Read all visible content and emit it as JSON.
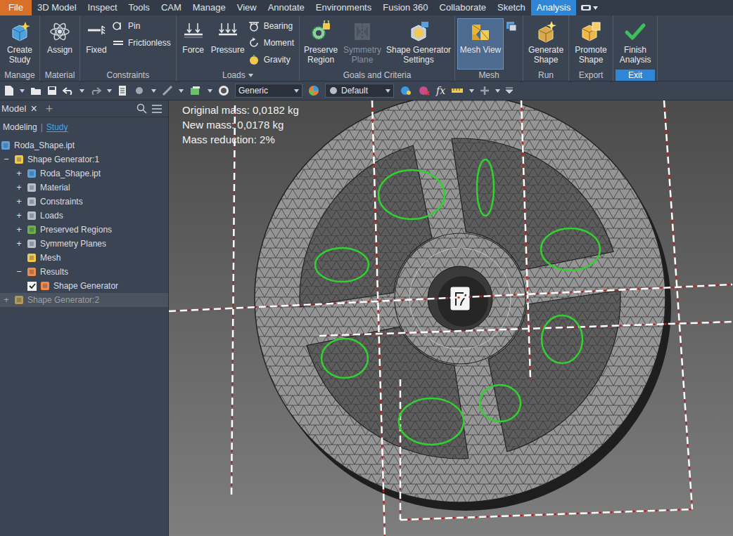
{
  "menu_tabs": [
    {
      "label": "File",
      "kind": "file",
      "selected": false
    },
    {
      "label": "3D Model",
      "kind": "tab",
      "selected": false
    },
    {
      "label": "Inspect",
      "kind": "tab",
      "selected": false
    },
    {
      "label": "Tools",
      "kind": "tab",
      "selected": false
    },
    {
      "label": "CAM",
      "kind": "tab",
      "selected": false
    },
    {
      "label": "Manage",
      "kind": "tab",
      "selected": false
    },
    {
      "label": "View",
      "kind": "tab",
      "selected": false
    },
    {
      "label": "Annotate",
      "kind": "tab",
      "selected": false
    },
    {
      "label": "Environments",
      "kind": "tab",
      "selected": false
    },
    {
      "label": "Fusion 360",
      "kind": "tab",
      "selected": false
    },
    {
      "label": "Collaborate",
      "kind": "tab",
      "selected": false
    },
    {
      "label": "Sketch",
      "kind": "tab",
      "selected": false
    },
    {
      "label": "Analysis",
      "kind": "tab",
      "selected": true
    }
  ],
  "ribbon": {
    "groups": [
      {
        "label": "Manage",
        "highlighted": false,
        "dropdown": false,
        "items": [
          {
            "kind": "large",
            "label": "Create Study",
            "disabled": false,
            "selected": false
          }
        ]
      },
      {
        "label": "Material",
        "highlighted": false,
        "dropdown": false,
        "items": [
          {
            "kind": "large",
            "label": "Assign",
            "disabled": false,
            "selected": false
          }
        ]
      },
      {
        "label": "Constraints",
        "highlighted": false,
        "dropdown": false,
        "items": [
          {
            "kind": "large",
            "label": "Fixed",
            "disabled": false,
            "selected": false
          },
          {
            "kind": "stack",
            "items": [
              {
                "label": "Pin"
              },
              {
                "label": "Frictionless"
              }
            ]
          }
        ]
      },
      {
        "label": "Loads",
        "highlighted": false,
        "dropdown": true,
        "items": [
          {
            "kind": "large",
            "label": "Force",
            "disabled": false,
            "selected": false
          },
          {
            "kind": "large",
            "label": "Pressure",
            "disabled": false,
            "selected": false
          },
          {
            "kind": "stack",
            "items": [
              {
                "label": "Bearing"
              },
              {
                "label": "Moment"
              },
              {
                "label": "Gravity"
              }
            ]
          }
        ]
      },
      {
        "label": "Goals and Criteria",
        "highlighted": false,
        "dropdown": false,
        "items": [
          {
            "kind": "large",
            "label": "Preserve Region",
            "disabled": false,
            "selected": false
          },
          {
            "kind": "large",
            "label": "Symmetry Plane",
            "disabled": true,
            "selected": false
          },
          {
            "kind": "large",
            "label": "Shape Generator Settings",
            "disabled": false,
            "selected": false
          }
        ]
      },
      {
        "label": "Mesh",
        "highlighted": false,
        "dropdown": false,
        "items": [
          {
            "kind": "large",
            "label": "Mesh View",
            "disabled": false,
            "selected": true
          },
          {
            "kind": "stack",
            "items": [
              {
                "label": ""
              }
            ]
          }
        ]
      },
      {
        "label": "Run",
        "highlighted": false,
        "dropdown": false,
        "items": [
          {
            "kind": "large",
            "label": "Generate Shape",
            "disabled": false,
            "selected": false
          }
        ]
      },
      {
        "label": "Export",
        "highlighted": false,
        "dropdown": false,
        "items": [
          {
            "kind": "large",
            "label": "Promote Shape",
            "disabled": false,
            "selected": false
          }
        ]
      },
      {
        "label": "Exit",
        "highlighted": true,
        "dropdown": false,
        "items": [
          {
            "kind": "large",
            "label": "Finish Analysis",
            "disabled": false,
            "selected": false
          }
        ]
      }
    ]
  },
  "quick_access": {
    "dropdowns": [
      {
        "value": "Generic"
      },
      {
        "value": "Default"
      }
    ],
    "fx": "fx"
  },
  "browser": {
    "title": "Model",
    "close": "×",
    "add": "+",
    "separator": "|",
    "tabs": [
      {
        "label": "Modeling",
        "selected": false
      },
      {
        "label": "Study",
        "selected": true
      }
    ],
    "tree": [
      {
        "label": "Roda_Shape.ipt",
        "level": 0,
        "expander": "",
        "kind": "node",
        "dimmed": false
      },
      {
        "label": "Shape Generator:1",
        "level": 0,
        "expander": "−",
        "kind": "node",
        "dimmed": false
      },
      {
        "label": "Roda_Shape.ipt",
        "level": 1,
        "expander": "+",
        "kind": "node",
        "dimmed": false
      },
      {
        "label": "Material",
        "level": 1,
        "expander": "+",
        "kind": "node",
        "dimmed": false
      },
      {
        "label": "Constraints",
        "level": 1,
        "expander": "+",
        "kind": "node",
        "dimmed": false
      },
      {
        "label": "Loads",
        "level": 1,
        "expander": "+",
        "kind": "node",
        "dimmed": false
      },
      {
        "label": "Preserved Regions",
        "level": 1,
        "expander": "+",
        "kind": "node",
        "dimmed": false
      },
      {
        "label": "Symmetry Planes",
        "level": 1,
        "expander": "+",
        "kind": "node",
        "dimmed": false
      },
      {
        "label": "Mesh",
        "level": 1,
        "expander": "",
        "kind": "node",
        "dimmed": false
      },
      {
        "label": "Results",
        "level": 1,
        "expander": "−",
        "kind": "node",
        "dimmed": false
      },
      {
        "label": "Shape Generator",
        "level": 2,
        "expander": "",
        "kind": "check",
        "checked": true,
        "dimmed": false
      },
      {
        "label": "Shape Generator:2",
        "level": 0,
        "expander": "+",
        "kind": "node",
        "dimmed": true
      }
    ]
  },
  "viewport": {
    "stats": [
      "Original mass: 0,0182 kg",
      "New mass: 0,0178 kg",
      "Mass reduction: 2%"
    ]
  }
}
